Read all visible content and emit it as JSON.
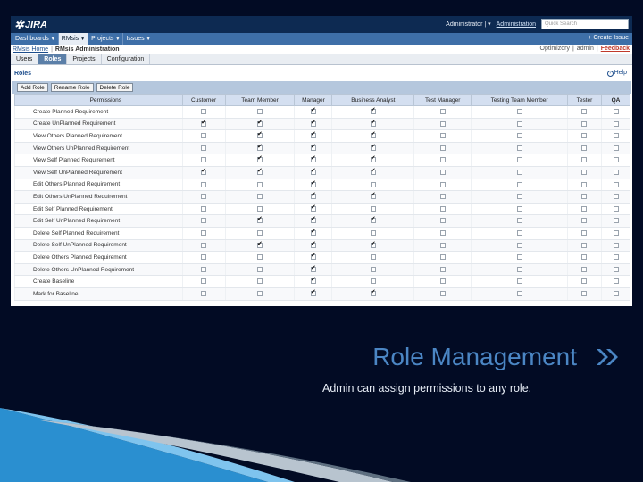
{
  "topbar": {
    "logo": "JIRA",
    "user": "Administrator",
    "admin_link": "Administration",
    "search_placeholder": "Quick Search"
  },
  "navbar": {
    "items": [
      "Dashboards",
      "RMsis",
      "Projects",
      "Issues"
    ],
    "create_issue": "+ Create Issue"
  },
  "breadcrumb": {
    "home": "RMsis Home",
    "sep": "|",
    "title": "RMsis Administration",
    "right": [
      "Optimizory",
      "|",
      "admin",
      "|",
      "Feedback"
    ]
  },
  "tabs": [
    "Users",
    "Roles",
    "Projects",
    "Configuration"
  ],
  "roles": {
    "title": "Roles",
    "help": "Help",
    "buttons": [
      "Add Role",
      "Rename Role",
      "Delete Role"
    ]
  },
  "table": {
    "columns": [
      "Permissions",
      "Customer",
      "Team Member",
      "Manager",
      "Business Analyst",
      "Test Manager",
      "Testing Team Member",
      "Tester",
      "QA"
    ],
    "rows": [
      {
        "name": "Create Planned Requirement",
        "checks": [
          0,
          0,
          1,
          1,
          0,
          0,
          0,
          0
        ]
      },
      {
        "name": "Create UnPlanned Requirement",
        "checks": [
          1,
          1,
          1,
          1,
          0,
          0,
          0,
          0
        ]
      },
      {
        "name": "View Others Planned Requirement",
        "checks": [
          0,
          1,
          1,
          1,
          0,
          0,
          0,
          0
        ]
      },
      {
        "name": "View Others UnPlanned Requirement",
        "checks": [
          0,
          1,
          1,
          1,
          0,
          0,
          0,
          0
        ]
      },
      {
        "name": "View Self Planned Requirement",
        "checks": [
          0,
          1,
          1,
          1,
          0,
          0,
          0,
          0
        ]
      },
      {
        "name": "View Self UnPlanned Requirement",
        "checks": [
          1,
          1,
          1,
          1,
          0,
          0,
          0,
          0
        ]
      },
      {
        "name": "Edit Others Planned Requirement",
        "checks": [
          0,
          0,
          1,
          0,
          0,
          0,
          0,
          0
        ]
      },
      {
        "name": "Edit Others UnPlanned Requirement",
        "checks": [
          0,
          0,
          1,
          1,
          0,
          0,
          0,
          0
        ]
      },
      {
        "name": "Edit Self Planned Requirement",
        "checks": [
          0,
          0,
          1,
          0,
          0,
          0,
          0,
          0
        ]
      },
      {
        "name": "Edit Self UnPlanned Requirement",
        "checks": [
          0,
          1,
          1,
          1,
          0,
          0,
          0,
          0
        ]
      },
      {
        "name": "Delete Self Planned Requirement",
        "checks": [
          0,
          0,
          1,
          0,
          0,
          0,
          0,
          0
        ]
      },
      {
        "name": "Delete Self UnPlanned Requirement",
        "checks": [
          0,
          1,
          1,
          1,
          0,
          0,
          0,
          0
        ]
      },
      {
        "name": "Delete Others Planned Requirement",
        "checks": [
          0,
          0,
          1,
          0,
          0,
          0,
          0,
          0
        ]
      },
      {
        "name": "Delete Others UnPlanned Requirement",
        "checks": [
          0,
          0,
          1,
          0,
          0,
          0,
          0,
          0
        ]
      },
      {
        "name": "Create Baseline",
        "checks": [
          0,
          0,
          1,
          0,
          0,
          0,
          0,
          0
        ]
      },
      {
        "name": "Mark for Baseline",
        "checks": [
          0,
          0,
          1,
          1,
          0,
          0,
          0,
          0
        ]
      }
    ]
  },
  "slide": {
    "title": "Role Management",
    "subtitle": "Admin can assign permissions to any role."
  },
  "colors": {
    "background": "#020b24",
    "topbar": "#0d2a52",
    "navbar": "#3e6fa8",
    "accent": "#4b86c4"
  },
  "icons": {
    "chevrons": "double-chevron-right-icon",
    "help": "help-icon",
    "checkbox": "checkbox-icon"
  }
}
